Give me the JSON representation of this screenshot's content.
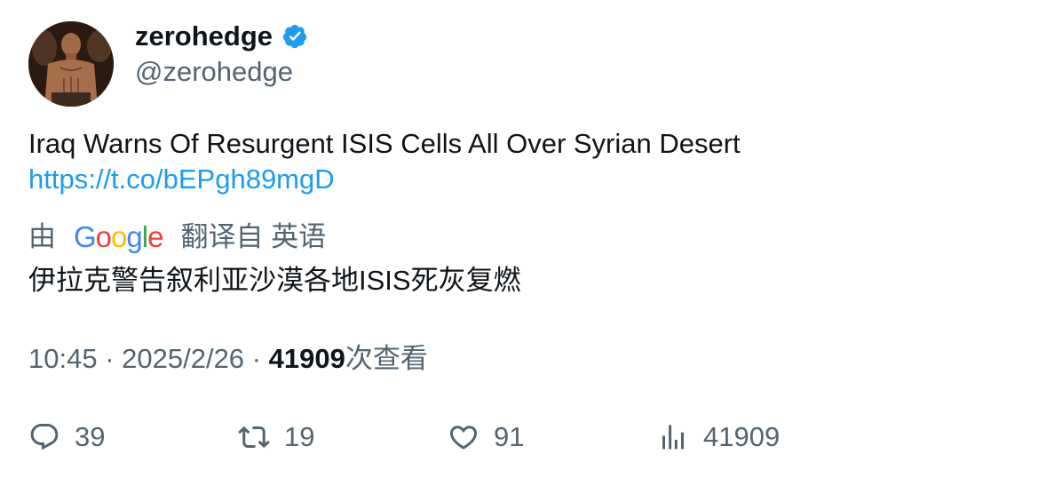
{
  "author": {
    "display_name": "zerohedge",
    "handle": "@zerohedge",
    "verified": true,
    "avatar_icon": "avatar-portrait"
  },
  "tweet": {
    "text": "Iraq Warns Of Resurgent ISIS Cells All Over Syrian Desert",
    "link": "https://t.co/bEPgh89mgD"
  },
  "translation": {
    "prefix": "由",
    "provider": "Google",
    "suffix": "翻译自 英语",
    "text": "伊拉克警告叙利亚沙漠各地ISIS死灰复燃"
  },
  "meta": {
    "time": "10:45",
    "date": "2025/2/26",
    "separator": " · ",
    "views": "41909",
    "views_label": "次查看"
  },
  "actions": {
    "replies": "39",
    "retweets": "19",
    "likes": "91",
    "views": "41909"
  },
  "colors": {
    "text": "#0f1419",
    "secondary": "#536471",
    "link": "#1d9bf0",
    "verified": "#1d9bf0"
  }
}
